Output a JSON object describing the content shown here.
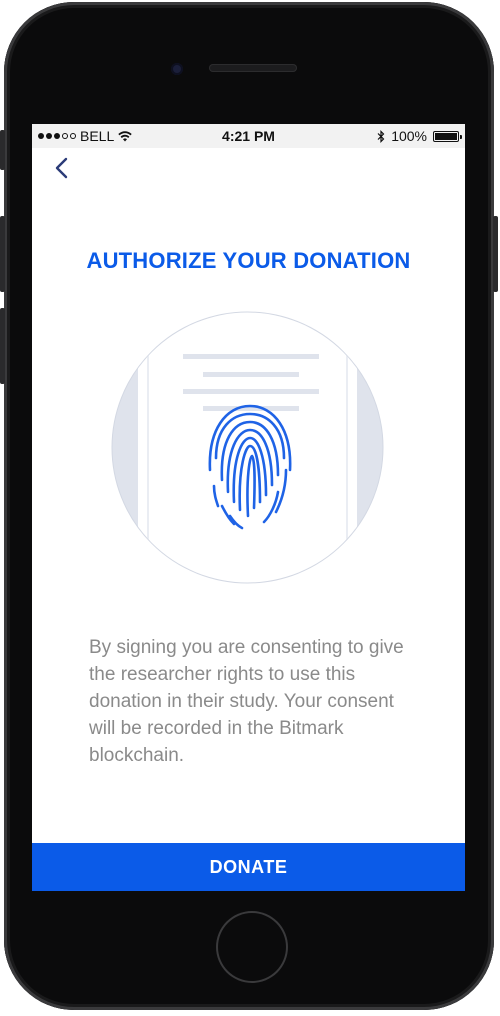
{
  "status_bar": {
    "carrier": "BELL",
    "time": "4:21 PM",
    "battery": "100%",
    "signal_icon": "signal-dots-icon",
    "wifi_icon": "wifi-icon",
    "bluetooth_icon": "bluetooth-icon",
    "battery_icon": "battery-icon"
  },
  "nav": {
    "back_icon": "chevron-left-icon"
  },
  "page": {
    "title": "AUTHORIZE YOUR DONATION",
    "illustration_icon": "fingerprint-document-icon",
    "description": "By signing you are consenting to give the researcher rights to use this donation in their study. Your consent will be recorded in the Bitmark blockchain.",
    "primary_button": "DONATE"
  },
  "colors": {
    "accent": "#0b5be8",
    "text_muted": "#8a8a8a",
    "status_bar_bg": "#f2f2f2"
  }
}
